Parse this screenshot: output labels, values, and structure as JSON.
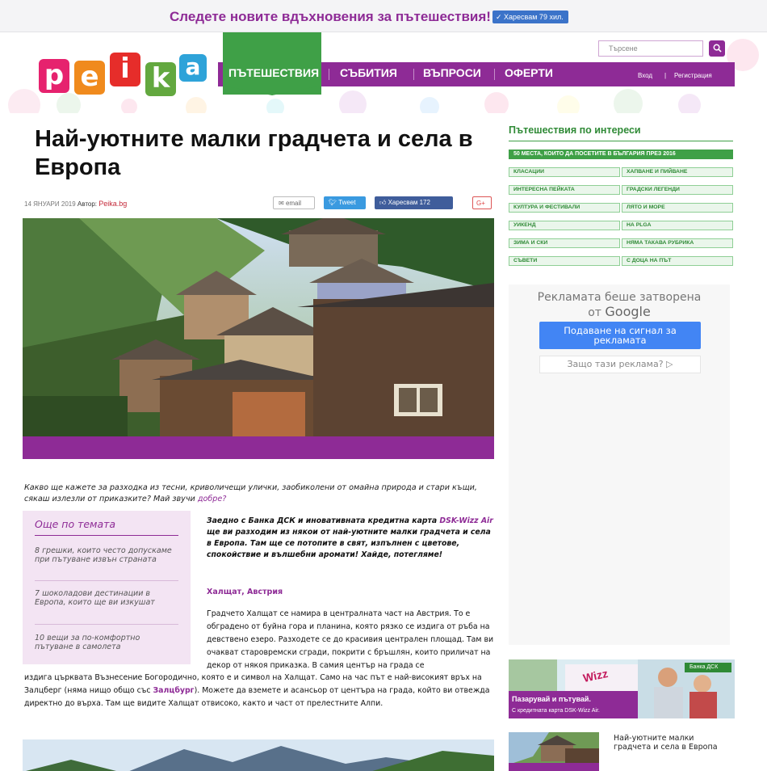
{
  "topbar": {
    "promo_text": "Следете новите вдъхновения за пътешествия!",
    "like_label": "✓ Харесвам 79 хил."
  },
  "header": {
    "logo_letters": [
      "p",
      "e",
      "i",
      "k",
      "a"
    ],
    "search_placeholder": "Търсене",
    "nav": {
      "travel": "ПЪТЕШЕСТВИЯ",
      "events": "СЪБИТИЯ",
      "questions": "ВЪПРОСИ",
      "offers": "ОФЕРТИ"
    },
    "login": "Вход",
    "divider": "|",
    "register": "Регистрация"
  },
  "article": {
    "title": "Най-уютните малки градчета и села в Европа",
    "date": "14 ЯНУАРИ 2019",
    "author_label": "Автор:",
    "author": "Peika.bg",
    "share": {
      "email": "email",
      "tweet": "Tweet",
      "facebook": "Харесвам 172",
      "gplus": "G+"
    },
    "intro_text": "Какво ще кажете за разходка из тесни, криволичещи улички, заобиколени от омайна природа и стари къщи, сякаш излезли от приказките? Май звучи ",
    "intro_link": "добре?",
    "more": {
      "title": "Още по темата",
      "items": [
        "8 грешки, които често допускаме при пътуване извън страната",
        "7 шоколадови дестинации в Европа, които ще ви изкушат",
        "10 вещи за по-комфортно пътуване в самолета"
      ]
    },
    "lead_before": "Заедно с Банка ДСК и иновативната кредитна карта ",
    "lead_link": "DSK-Wizz Air",
    "lead_after": " ще ви разходим из някои от най-уютните малки градчета и села в Европа. Там ще се потопите в свят, изпълнен с цветове, спокойствие и вълшебни аромати! Хайде, потегляме!",
    "subhead": "Халщат, Австрия",
    "para1": "Градчето Халщат се намира в централната част на Австрия. То е обградено от буйна гора и планина, която рязко се издига от ръба на девствено езеро. Разходете се до красивия централен площад. Там ви очакват старовремски сгради, покрити с бръшлян, които приличат на декор от някоя приказка. В самия център на града се",
    "para2_before": "издига църквата Възнесение Богородично, която е и символ на Халщат. Само на час път е най-високият връх на Залцберг (нямa нищо общо със ",
    "para2_link": "Залцбург",
    "para2_after": "). Можете да вземете и асансьор от центъра на града, който ви отвежда директно до върха. Там ще видите Халщат отвисоко, както и част от прелестните Алпи."
  },
  "sidebar": {
    "title": "Пътешествия по интереси",
    "banner": "50 МЕСТА, КОИТО ДА ПОСЕТИТЕ В БЪЛГАРИЯ ПРЕЗ 2016",
    "tags_left": [
      "КЛАСАЦИИ",
      "ИНТЕРЕСНА ПЕЙКАТА",
      "КУЛТУРА И ФЕСТИВАЛИ",
      "УИКЕНД",
      "ЗИМА И СКИ",
      "СЪВЕТИ"
    ],
    "tags_right": [
      "ХАПВАНЕ И ПИЙВАНЕ",
      "ГРАДСКИ ЛЕГЕНДИ",
      "ЛЯТО И МОРЕ",
      "НА PLGA",
      "НЯМА ТАКАВА РУБРИКА",
      "С ДОЦА НА ПЪТ"
    ],
    "ad_closed_line1": "Рекламата беше затворена",
    "ad_closed_line2": "от",
    "ad_google": "Google",
    "ad_report": "Подаване на сигнал за рекламата",
    "ad_why": "Защо тази реклама? ▷",
    "promo_line1": "Пазарувай и пътувай.",
    "promo_line2": "С кредитната карта DSK-Wizz Air.",
    "promo_badge": "Банка ДСК",
    "promo_brand": "Wizz",
    "related_title": "Най-уютните малки градчета и села в Европа"
  },
  "colors": {
    "brand_purple": "#8e2b96",
    "brand_green": "#3fa047",
    "google_blue": "#4285f4"
  }
}
